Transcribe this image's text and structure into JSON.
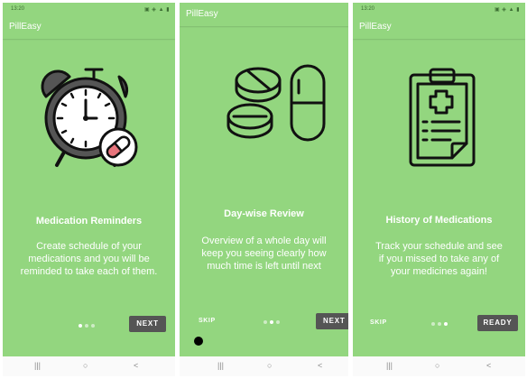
{
  "colors": {
    "background": "#93d67f",
    "button": "#555555",
    "text": "#ffffff",
    "nav_bar": "#fafafa"
  },
  "status_bar": {
    "time": "13:20",
    "icons": "▣ ◈ ▲ ▮"
  },
  "navigation_bar": {
    "recents": "|||",
    "home": "○",
    "back": "<"
  },
  "screens": [
    {
      "app_title": "PillEasy",
      "illustration": "alarm-clock-pill-icon",
      "title": "Medication Reminders",
      "description": "Create schedule of your medications and you will be reminded to take each of them.",
      "page_index": 1,
      "page_count": 3,
      "skip_label": "",
      "primary_label": "NEXT"
    },
    {
      "app_title": "PillEasy",
      "illustration": "pills-capsule-icon",
      "title": "Day-wise Review",
      "description": "Overview of a whole day will keep you seeing clearly how much time is left until next",
      "page_index": 2,
      "page_count": 3,
      "skip_label": "SKIP",
      "primary_label": "NEXT"
    },
    {
      "app_title": "PillEasy",
      "illustration": "medical-clipboard-icon",
      "title": "History of Medications",
      "description": "Track your schedule and see if you missed to take any of your medicines again!",
      "page_index": 3,
      "page_count": 3,
      "skip_label": "SKIP",
      "primary_label": "READY"
    }
  ]
}
